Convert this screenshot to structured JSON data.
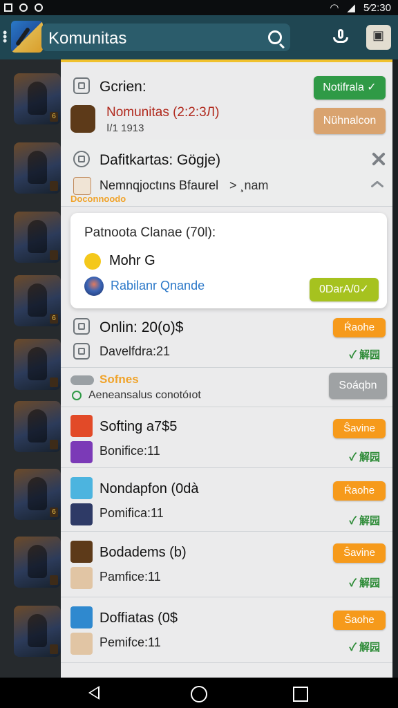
{
  "status_bar": {
    "time": "5⁄2:30"
  },
  "appbar": {
    "title": "Komunitas"
  },
  "rail": {
    "badges": [
      "6",
      "",
      "",
      "6",
      "",
      "",
      "6",
      "",
      "",
      ""
    ]
  },
  "section1": {
    "heading": "Gcrien:",
    "subtitle": "Nomunitas (2:2:3Л)",
    "meta": "Ⅰ/1 1913",
    "btn_primary": "Notifrala ✓",
    "btn_secondary": "Nühnalcon"
  },
  "section2": {
    "heading": "Dafitkartas: Gögje)",
    "line": "Nemnqjoctıns Bfaurel",
    "line_suffix": "> ¸nam",
    "accent": "Doconnoodo"
  },
  "card": {
    "title": "Patnoota Clanae (70l):",
    "item1": "Mohr G",
    "item2": "Rabilanr Qnande",
    "btn": "0DarA/0✓"
  },
  "section3": {
    "heading": "Onlin: 20(o)$",
    "line": "Davelfdra:21",
    "btn": "Ŕaohe",
    "check": "✓ 解园"
  },
  "section4": {
    "heading": "Sofnes",
    "line": "Aeneansalus conotóıot",
    "btn": "Soáqbn"
  },
  "list": [
    {
      "title": "Softing a7$5",
      "subtitle": "Bonifice:11",
      "btn": "Ŝavine",
      "check": "✓ 解园"
    },
    {
      "title": "Nondapfon (0dà",
      "subtitle": "Pomifica:11",
      "btn": "Ŕaohe",
      "check": "✓ 解园"
    },
    {
      "title": "Bodadems (b)",
      "subtitle": "Pamfice:11",
      "btn": "Ŝavine",
      "check": "✓ 解园"
    },
    {
      "title": "Doffiatas (0$",
      "subtitle": "Pemifce:11",
      "btn": "Ŝaohe",
      "check": "✓ 解园"
    }
  ],
  "colors": {
    "appbar": "#1f4652",
    "accent": "#f0c12d",
    "green": "#2f9a46",
    "orange": "#f69a1b"
  }
}
